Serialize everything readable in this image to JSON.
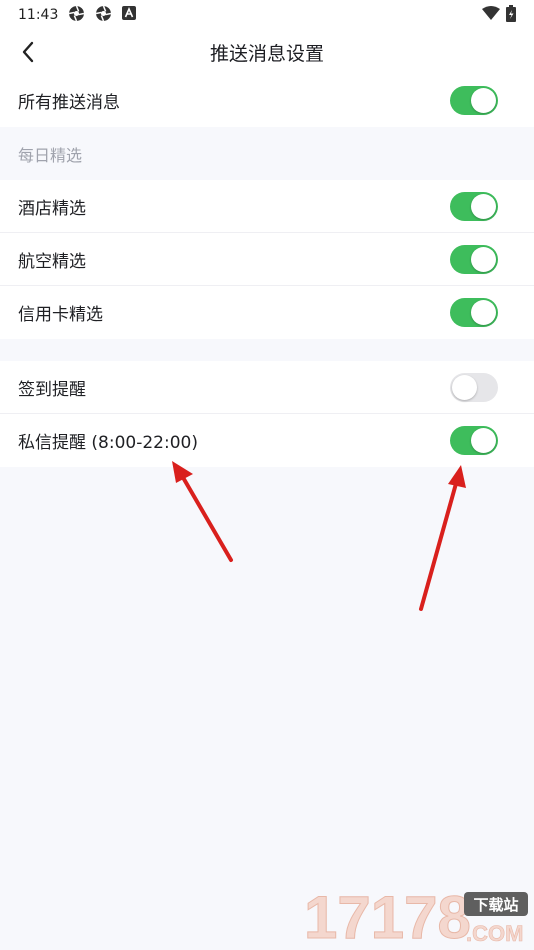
{
  "status_bar": {
    "time": "11:43"
  },
  "header": {
    "title": "推送消息设置"
  },
  "settings": {
    "all_push": {
      "label": "所有推送消息",
      "on": true
    },
    "daily_header": "每日精选",
    "hotel": {
      "label": "酒店精选",
      "on": true
    },
    "flight": {
      "label": "航空精选",
      "on": true
    },
    "credit_card": {
      "label": "信用卡精选",
      "on": true
    },
    "checkin": {
      "label": "签到提醒",
      "on": false
    },
    "message": {
      "label": "私信提醒 (8:00-22:00)",
      "on": true
    }
  },
  "watermark": {
    "brand": "17178",
    "badge": "下载站",
    "suffix": ".COM"
  },
  "colors": {
    "toggle_on": "#3ebd5c",
    "toggle_off": "#e6e6e9",
    "arrow": "#d9201d"
  }
}
